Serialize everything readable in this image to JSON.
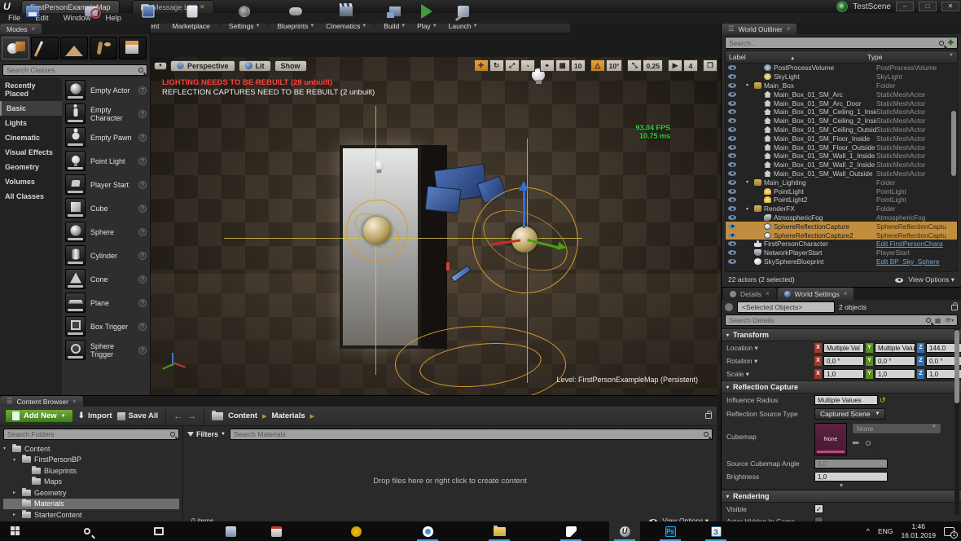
{
  "window": {
    "tabs": [
      {
        "label": "FirstPersonExampleMap"
      },
      {
        "label": "Message Log"
      }
    ],
    "right_title": "TestScene",
    "controls": {
      "minimize": "–",
      "maximize": "□",
      "close": "✕"
    }
  },
  "menu": {
    "items": [
      "File",
      "Edit",
      "Window",
      "Help"
    ]
  },
  "modes": {
    "title": "Modes",
    "search_placeholder": "Search Classes",
    "categories": [
      {
        "label": "Recently Placed",
        "cls": ""
      },
      {
        "label": "Basic",
        "cls": "sel"
      },
      {
        "label": "Lights",
        "cls": ""
      },
      {
        "label": "Cinematic",
        "cls": ""
      },
      {
        "label": "Visual Effects",
        "cls": ""
      },
      {
        "label": "Geometry",
        "cls": ""
      },
      {
        "label": "Volumes",
        "cls": ""
      },
      {
        "label": "All Classes",
        "cls": ""
      }
    ],
    "items": [
      {
        "label": "Empty Actor",
        "icon": "ball"
      },
      {
        "label": "Empty Character",
        "icon": "person"
      },
      {
        "label": "Empty Pawn",
        "icon": "pawn"
      },
      {
        "label": "Point Light",
        "icon": "bulb"
      },
      {
        "label": "Player Start",
        "icon": "pstart"
      },
      {
        "label": "Cube",
        "icon": "cube"
      },
      {
        "label": "Sphere",
        "icon": "ball"
      },
      {
        "label": "Cylinder",
        "icon": "cyl"
      },
      {
        "label": "Cone",
        "icon": "cone"
      },
      {
        "label": "Plane",
        "icon": "plane"
      },
      {
        "label": "Box Trigger",
        "icon": "boxtrig"
      },
      {
        "label": "Sphere Trigger",
        "icon": "sphtrig"
      }
    ]
  },
  "toolbar": {
    "buttons": [
      {
        "label": "Save Current",
        "icon": "floppy",
        "dropdown": "",
        "sep": ""
      },
      {
        "label": "Source Control",
        "icon": "srcctl",
        "dropdown": "▼",
        "sep": "y"
      },
      {
        "label": "Content",
        "icon": "content",
        "dropdown": "",
        "sep": ""
      },
      {
        "label": "Marketplace",
        "icon": "market",
        "dropdown": "",
        "sep": "y"
      },
      {
        "label": "Settings",
        "icon": "gear",
        "dropdown": "▼",
        "sep": "y"
      },
      {
        "label": "Blueprints",
        "icon": "gamepad",
        "dropdown": "▼",
        "sep": ""
      },
      {
        "label": "Cinematics",
        "icon": "clap",
        "dropdown": "▼",
        "sep": "y"
      },
      {
        "label": "Build",
        "icon": "build",
        "dropdown": "▼",
        "sep": ""
      },
      {
        "label": "Play",
        "icon": "play",
        "dropdown": "▼",
        "sep": ""
      },
      {
        "label": "Launch",
        "icon": "launch",
        "dropdown": "▼",
        "sep": ""
      }
    ]
  },
  "viewport": {
    "dropdown_caret": "▼",
    "perspective": "Perspective",
    "lit": "Lit",
    "show": "Show",
    "warning1": "LIGHTING NEEDS TO BE REBUILT (28 unbuilt)",
    "warning2": "REFLECTION CAPTURES NEED TO BE REBUILT (2 unbuilt)",
    "fps": "93.04 FPS",
    "ms": "10.75 ms",
    "level_label": "Level:  FirstPersonExampleMap (Persistent)",
    "snap": {
      "grid": "10",
      "angle": "10°",
      "scale": "0,25",
      "camera": "4"
    }
  },
  "outliner": {
    "title": "World Outliner",
    "search_placeholder": "Search...",
    "col_label": "Label",
    "col_type": "Type",
    "sort_arrow": "▲",
    "rows": [
      {
        "label": "PostProcessVolume",
        "type": "PostProcessVolume",
        "ind": "ind2",
        "icon": "ic-ppv",
        "arrow": "",
        "cls": "",
        "typecls": ""
      },
      {
        "label": "SkyLight",
        "type": "SkyLight",
        "ind": "ind2",
        "icon": "ic-sky",
        "arrow": "",
        "cls": "",
        "typecls": ""
      },
      {
        "label": "Main_Box",
        "type": "Folder",
        "ind": "ind1",
        "icon": "ic-folder",
        "arrow": "▾",
        "cls": "",
        "typecls": ""
      },
      {
        "label": "Main_Box_01_SM_Arc",
        "type": "StaticMeshActor",
        "ind": "ind2",
        "icon": "ic-mesh",
        "arrow": "",
        "cls": "",
        "typecls": ""
      },
      {
        "label": "Main_Box_01_SM_Arc_Door",
        "type": "StaticMeshActor",
        "ind": "ind2",
        "icon": "ic-mesh",
        "arrow": "",
        "cls": "",
        "typecls": ""
      },
      {
        "label": "Main_Box_01_SM_Ceiling_1_Inside",
        "type": "StaticMeshActor",
        "ind": "ind2",
        "icon": "ic-mesh",
        "arrow": "",
        "cls": "",
        "typecls": ""
      },
      {
        "label": "Main_Box_01_SM_Ceiling_2_Inside",
        "type": "StaticMeshActor",
        "ind": "ind2",
        "icon": "ic-mesh",
        "arrow": "",
        "cls": "",
        "typecls": ""
      },
      {
        "label": "Main_Box_01_SM_Ceiling_Outside",
        "type": "StaticMeshActor",
        "ind": "ind2",
        "icon": "ic-mesh",
        "arrow": "",
        "cls": "",
        "typecls": ""
      },
      {
        "label": "Main_Box_01_SM_Floor_Inside",
        "type": "StaticMeshActor",
        "ind": "ind2",
        "icon": "ic-mesh",
        "arrow": "",
        "cls": "",
        "typecls": ""
      },
      {
        "label": "Main_Box_01_SM_Floor_Outside",
        "type": "StaticMeshActor",
        "ind": "ind2",
        "icon": "ic-mesh",
        "arrow": "",
        "cls": "",
        "typecls": ""
      },
      {
        "label": "Main_Box_01_SM_Wall_1_Inside",
        "type": "StaticMeshActor",
        "ind": "ind2",
        "icon": "ic-mesh",
        "arrow": "",
        "cls": "",
        "typecls": ""
      },
      {
        "label": "Main_Box_01_SM_Wall_2_Inside",
        "type": "StaticMeshActor",
        "ind": "ind2",
        "icon": "ic-mesh",
        "arrow": "",
        "cls": "",
        "typecls": ""
      },
      {
        "label": "Main_Box_01_SM_Wall_Outside",
        "type": "StaticMeshActor",
        "ind": "ind2",
        "icon": "ic-mesh",
        "arrow": "",
        "cls": "",
        "typecls": ""
      },
      {
        "label": "Main_Lighting",
        "type": "Folder",
        "ind": "ind1",
        "icon": "ic-folder",
        "arrow": "▾",
        "cls": "",
        "typecls": ""
      },
      {
        "label": "PointLight",
        "type": "PointLight",
        "ind": "ind2",
        "icon": "ic-light",
        "arrow": "",
        "cls": "",
        "typecls": ""
      },
      {
        "label": "PointLight2",
        "type": "PointLight",
        "ind": "ind2",
        "icon": "ic-light",
        "arrow": "",
        "cls": "",
        "typecls": ""
      },
      {
        "label": "RenderFX",
        "type": "Folder",
        "ind": "ind1",
        "icon": "ic-folder",
        "arrow": "▾",
        "cls": "",
        "typecls": ""
      },
      {
        "label": "AtmosphericFog",
        "type": "AtmosphericFog",
        "ind": "ind2",
        "icon": "ic-fog",
        "arrow": "",
        "cls": "",
        "typecls": ""
      },
      {
        "label": "SphereReflectionCapture",
        "type": "SphereReflectionCaptu",
        "ind": "ind2",
        "icon": "ic-cap",
        "arrow": "",
        "cls": "sel",
        "typecls": ""
      },
      {
        "label": "SphereReflectionCapture2",
        "type": "SphereReflectionCaptu",
        "ind": "ind2",
        "icon": "ic-cap",
        "arrow": "",
        "cls": "sel",
        "typecls": ""
      },
      {
        "label": "FirstPersonCharacter",
        "type": "Edit FirstPersonChara",
        "ind": "ind1",
        "icon": "ic-char",
        "arrow": "",
        "cls": "",
        "typecls": "link"
      },
      {
        "label": "NetworkPlayerStart",
        "type": "PlayerStart",
        "ind": "ind1",
        "icon": "ic-ps",
        "arrow": "",
        "cls": "",
        "typecls": ""
      },
      {
        "label": "SkySphereBlueprint",
        "type": "Edit BP_Sky_Sphere",
        "ind": "ind1",
        "icon": "ic-bp",
        "arrow": "",
        "cls": "",
        "typecls": "link"
      }
    ],
    "footer": "22 actors (2 selected)",
    "view_options": "View Options"
  },
  "details": {
    "tab_details": "Details",
    "tab_world_settings": "World Settings",
    "selected_objects": "<Selected Objects>",
    "objects_count": "2 objects",
    "search_placeholder": "Search Details",
    "transform_header": "Transform",
    "transform_rows": [
      {
        "label": "Location ▾",
        "x": "Multiple Val",
        "y": "Multiple Valu",
        "z": "144,0",
        "end": "↺"
      },
      {
        "label": "Rotation ▾",
        "x": "0,0 °",
        "y": "0,0 °",
        "z": "0,0 °",
        "end": ""
      },
      {
        "label": "Scale ▾",
        "x": "1,0",
        "y": "1,0",
        "z": "1,0",
        "end": "🔒"
      }
    ],
    "reflection_header": "Reflection Capture",
    "influence_label": "Influence Radius",
    "influence_value": "Multiple Values",
    "source_label": "Reflection Source Type",
    "source_value": "Captured Scene",
    "cubemap_label": "Cubemap",
    "cubemap_thumb": "None",
    "cubemap_dropdown": "None",
    "angle_label": "Source Cubemap Angle",
    "angle_value": "0,0",
    "brightness_label": "Brightness",
    "brightness_value": "1,0",
    "rendering_header": "Rendering",
    "visible_label": "Visible",
    "hidden_label": "Actor Hidden In Game",
    "check_glyph": "✓"
  },
  "content_browser": {
    "title": "Content Browser",
    "add_new": "Add New",
    "import": "Import",
    "save_all": "Save All",
    "crumb_root": "Content",
    "crumb_current": "Materials",
    "search_folders_placeholder": "Search Folders",
    "filters": "Filters",
    "search_assets_placeholder": "Search Materials",
    "tree": [
      {
        "label": "Content",
        "ind": "cind0",
        "arrow": "▾",
        "cls": ""
      },
      {
        "label": "FirstPersonBP",
        "ind": "cind1",
        "arrow": "▾",
        "cls": ""
      },
      {
        "label": "Blueprints",
        "ind": "cind2",
        "arrow": "",
        "cls": ""
      },
      {
        "label": "Maps",
        "ind": "cind2",
        "arrow": "",
        "cls": ""
      },
      {
        "label": "Geometry",
        "ind": "cind1",
        "arrow": "▸",
        "cls": ""
      },
      {
        "label": "Materials",
        "ind": "cind1",
        "arrow": "",
        "cls": "sel"
      },
      {
        "label": "StarterContent",
        "ind": "cind1",
        "arrow": "▸",
        "cls": ""
      }
    ],
    "drop_hint": "Drop files here or right click to create content",
    "items_count": "0 items",
    "view_options": "View Options"
  },
  "taskbar": {
    "lang": "ENG",
    "time": "1:46",
    "date": "16.01.2019",
    "badge": "1"
  }
}
